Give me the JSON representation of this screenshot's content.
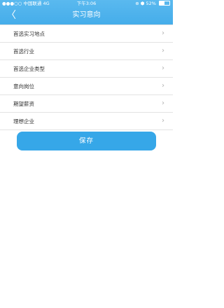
{
  "status": {
    "carrier": "●●●○○ 中国联通  4G",
    "time": "下午3:06",
    "indicators": "⊕ ⬢  52%",
    "battery_level": 0.52
  },
  "nav": {
    "back_glyph": "〈",
    "title": "实习意向"
  },
  "rows": [
    {
      "label": "首选实习地点",
      "chevron": "›"
    },
    {
      "label": "首选行业",
      "chevron": "›"
    },
    {
      "label": "首选企业类型",
      "chevron": "›"
    },
    {
      "label": "意向岗位",
      "chevron": "›"
    },
    {
      "label": "期望薪资",
      "chevron": "›"
    },
    {
      "label": "理想企业",
      "chevron": "›"
    }
  ],
  "save_label": "保存",
  "colors": {
    "header": "#45adea",
    "button": "#36a7e8"
  }
}
